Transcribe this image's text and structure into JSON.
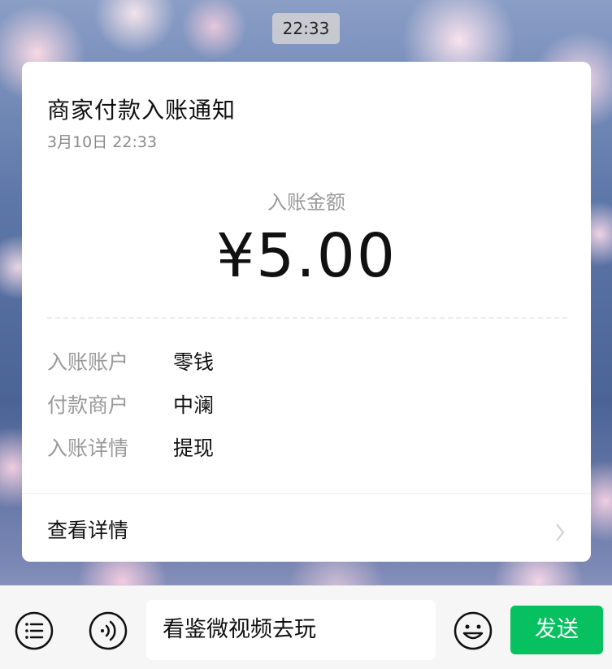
{
  "timestamp_pill": "22:33",
  "card": {
    "title": "商家付款入账通知",
    "date": "3月10日  22:33",
    "amount_label": "入账金额",
    "amount_value": "¥5.00",
    "details": [
      {
        "label": "入账账户",
        "value": "零钱"
      },
      {
        "label": "付款商户",
        "value": "中澜"
      },
      {
        "label": "入账详情",
        "value": "提现"
      }
    ],
    "view_detail_label": "查看详情",
    "chevron_icon": "chevron-right-icon"
  },
  "input_bar": {
    "menu_icon": "menu-list-icon",
    "voice_icon": "voice-icon",
    "input_value": "看鉴微视频去玩",
    "emoji_icon": "emoji-icon",
    "send_label": "发送"
  },
  "colors": {
    "send_button": "#07c160",
    "card_bg": "#ffffff",
    "muted_text": "#9a9a9a"
  }
}
